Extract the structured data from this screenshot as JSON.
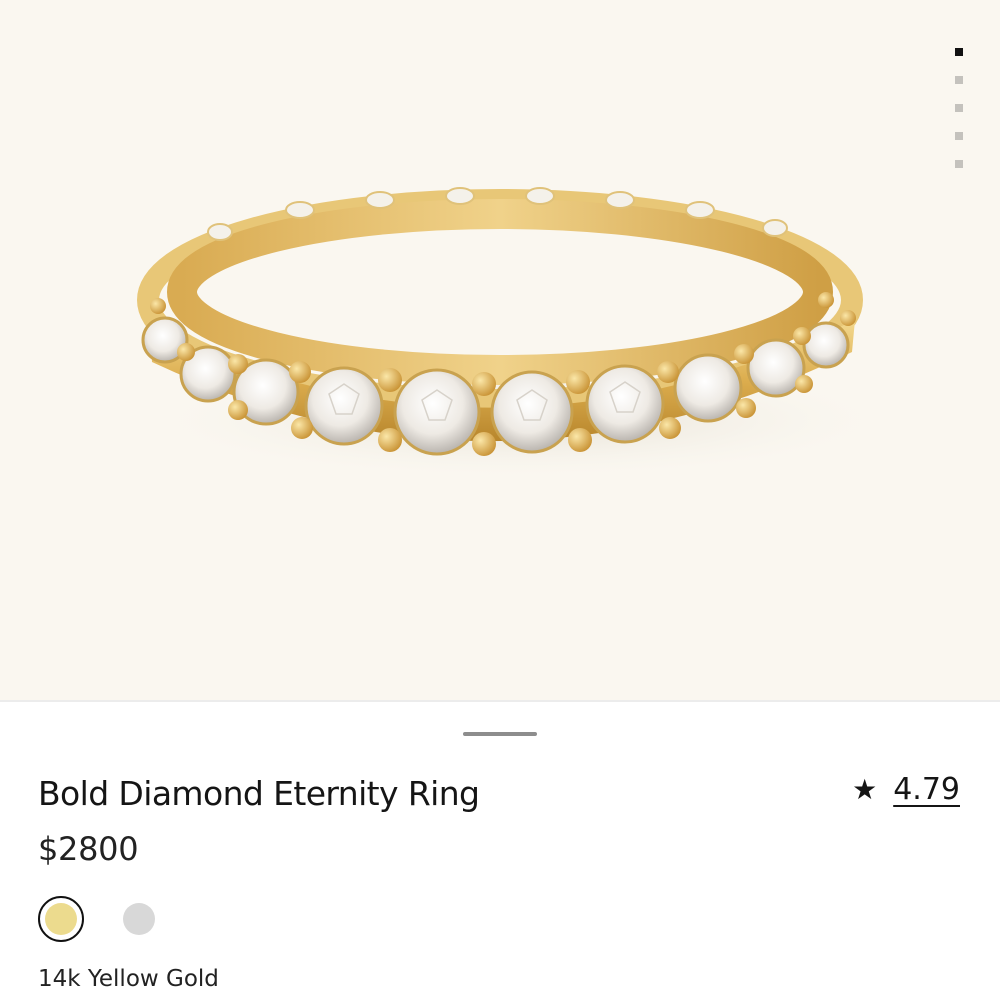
{
  "gallery": {
    "image_name": "ring-photo",
    "page_count": 5,
    "active_index": 0
  },
  "product": {
    "title": "Bold Diamond Eternity Ring",
    "price": "$2800",
    "rating": {
      "icon": "star-icon",
      "value": "4.79"
    },
    "metal_options": [
      {
        "name": "yellow-gold",
        "color": "#ecdb8e",
        "selected": true
      },
      {
        "name": "white-gold",
        "color": "#d8d8d8",
        "selected": false
      }
    ],
    "selected_metal_label": "14k Yellow Gold"
  },
  "colors": {
    "background": "#faf7f0",
    "gold": "#e2b65a",
    "text": "#151515"
  }
}
